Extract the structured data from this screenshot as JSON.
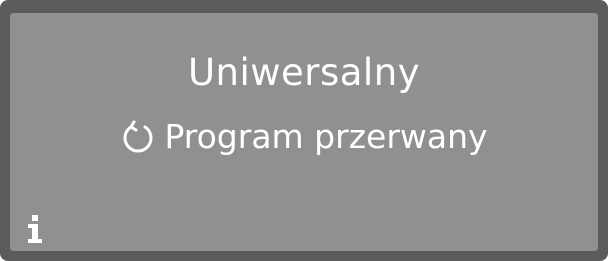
{
  "display": {
    "program_name": "Uniwersalny",
    "status_text": "Program przerwany",
    "status_icon": "restart-icon",
    "info_icon": "info-icon"
  },
  "colors": {
    "bezel": "#5b5b5b",
    "screen": "#909090",
    "text": "#ffffff"
  }
}
